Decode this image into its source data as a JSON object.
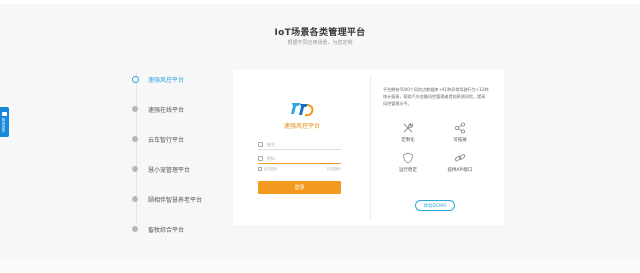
{
  "section": {
    "title": "IoT场景各类管理平台",
    "subtitle": "根据不同应用场景，为您定制"
  },
  "nav": {
    "items": [
      {
        "label": "速强风控平台",
        "active": true
      },
      {
        "label": "速强在线平台",
        "active": false
      },
      {
        "label": "云车智行平台",
        "active": false
      },
      {
        "label": "慧小宠管理平台",
        "active": false
      },
      {
        "label": "颐相伴智慧养老平台",
        "active": false
      },
      {
        "label": "畜牧综合平台",
        "active": false
      }
    ]
  },
  "login": {
    "brand": "速强风控平台",
    "username_placeholder": "账号",
    "password_placeholder": "密码",
    "remember_label": "记住密码",
    "forgot_label": "忘记密码?",
    "login_button": "登录"
  },
  "info": {
    "description": "平台拥有5000个风险点数据库+41种异常驾驶行为+12种统计报表，帮助汽车金融风控管理者提前预测风险，提高风控管理水平。",
    "features": [
      {
        "label": "定制化",
        "icon": "tools-icon"
      },
      {
        "label": "可拓展",
        "icon": "share-icon"
      },
      {
        "label": "运行稳定",
        "icon": "shield-icon"
      },
      {
        "label": "提供API接口",
        "icon": "link-icon"
      }
    ],
    "demo_button": "体验DEMO"
  },
  "side_tab": {
    "label": "商务合作"
  },
  "colors": {
    "accent_blue": "#2ea7e0",
    "accent_orange": "#f39a1e"
  }
}
